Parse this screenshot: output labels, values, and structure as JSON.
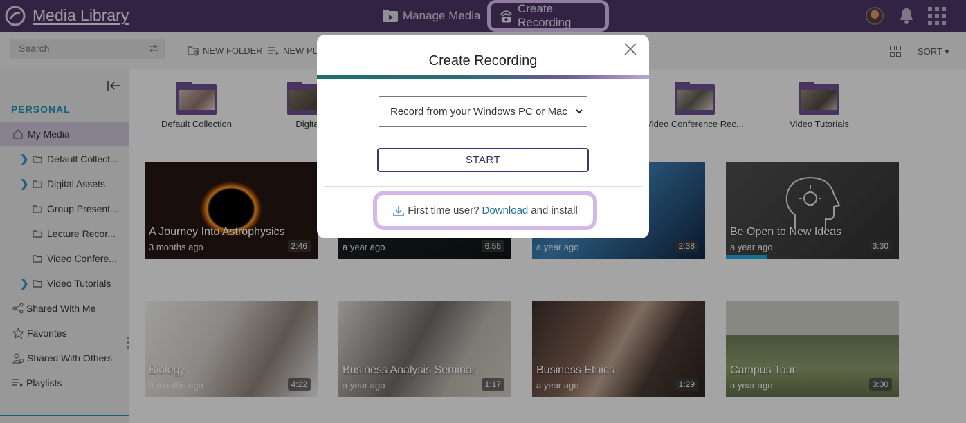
{
  "app": {
    "title": "Media Library"
  },
  "nav": {
    "manage_media": "Manage Media",
    "create_recording": "Create Recording"
  },
  "toolbar": {
    "search_placeholder": "Search",
    "new_folder": "NEW FOLDER",
    "new_playlist": "NEW PLA",
    "sort": "SORT"
  },
  "sidebar": {
    "section": "PERSONAL",
    "my_media": "My Media",
    "folders": [
      {
        "label": "Default Collect...",
        "expandable": true
      },
      {
        "label": "Digital Assets",
        "expandable": true
      },
      {
        "label": "Group Present...",
        "expandable": false
      },
      {
        "label": "Lecture Recor...",
        "expandable": false
      },
      {
        "label": "Video Confere...",
        "expandable": false
      },
      {
        "label": "Video Tutorials",
        "expandable": true
      }
    ],
    "links": [
      {
        "label": "Shared With Me",
        "icon": "share-icon"
      },
      {
        "label": "Favorites",
        "icon": "star-icon"
      },
      {
        "label": "Shared With Others",
        "icon": "users-icon"
      },
      {
        "label": "Playlists",
        "icon": "playlist-icon"
      }
    ]
  },
  "folders": [
    {
      "label": "Default Collection"
    },
    {
      "label": "Digita"
    },
    {
      "label": "Video Conference Rec..."
    },
    {
      "label": "Video Tutorials"
    }
  ],
  "videos": [
    {
      "title": "A Journey Into Astrophysics",
      "date": "3 months ago",
      "duration": "2:46"
    },
    {
      "title": "",
      "date": "a year ago",
      "duration": "6:55"
    },
    {
      "title": "",
      "date": "a year ago",
      "duration": "2:38"
    },
    {
      "title": "Be Open to New Ideas",
      "date": "a year ago",
      "duration": "3:30",
      "progress": 0.24
    },
    {
      "title": "Biology",
      "date": "9 months ago",
      "duration": "4:22"
    },
    {
      "title": "Business Analysis Seminar",
      "date": "a year ago",
      "duration": "1:17"
    },
    {
      "title": "Business Ethics",
      "date": "a year ago",
      "duration": "1:29"
    },
    {
      "title": "Campus Tour",
      "date": "a year ago",
      "duration": "3:30"
    }
  ],
  "modal": {
    "title": "Create Recording",
    "select_value": "Record from your Windows PC or Mac",
    "start": "START",
    "first_time": "First time user?",
    "download": "Download",
    "install": "and install"
  },
  "colors": {
    "topbar": "#4a3466",
    "highlight": "#d5b8ea",
    "accent_blue": "#1f8fb0",
    "link": "#1b6f9a"
  }
}
